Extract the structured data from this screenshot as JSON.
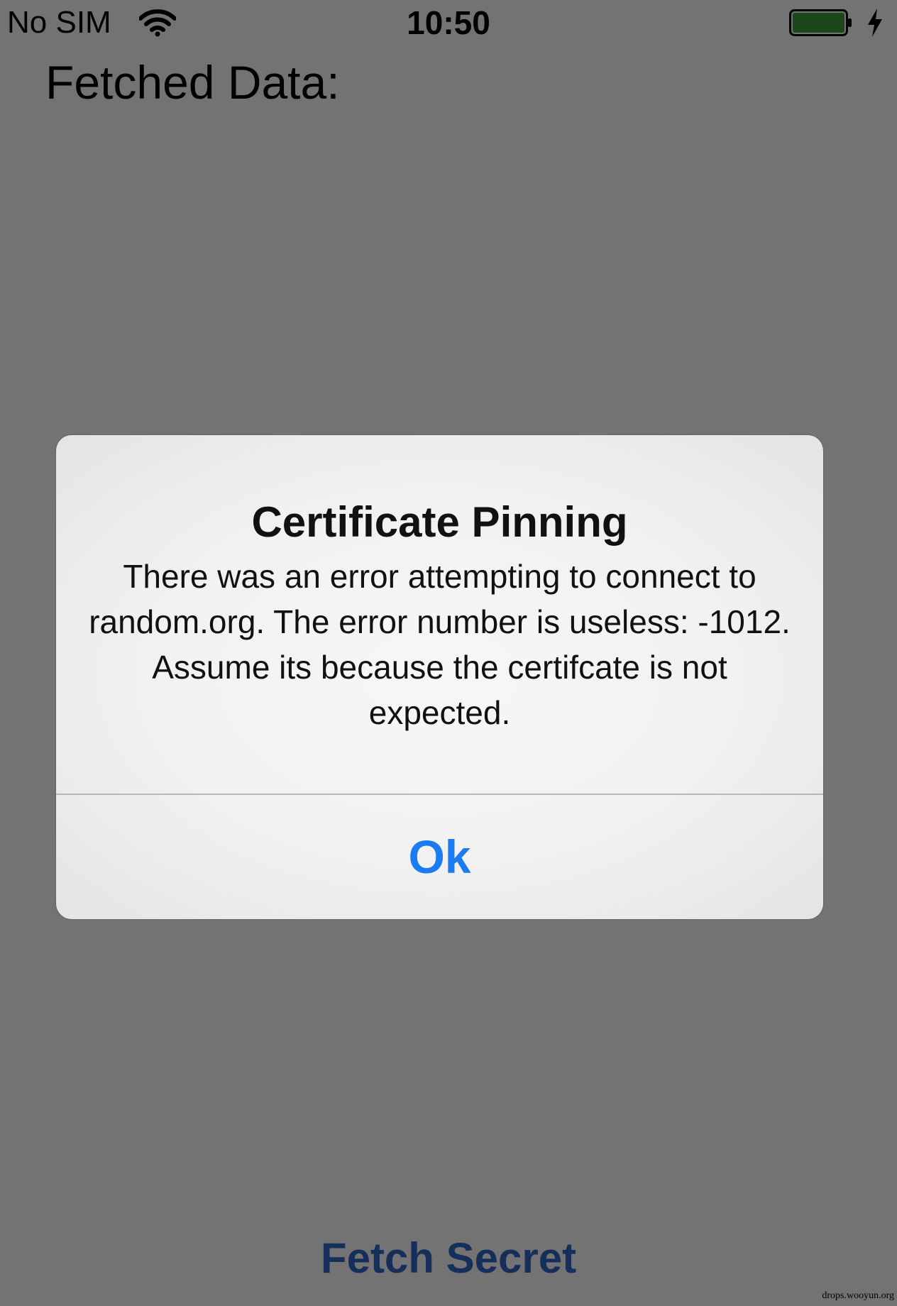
{
  "status_bar": {
    "carrier": "No SIM",
    "time": "10:50",
    "battery_color": "#3aa03a"
  },
  "main": {
    "fetched_label": "Fetched Data:",
    "fetch_button_label": "Fetch Secret"
  },
  "alert": {
    "title": "Certificate Pinning",
    "message": "There was an error attempting to connect to random.org. The error number is useless: -1012. Assume its because the certifcate is not expected.",
    "ok_label": "Ok"
  },
  "watermark": "drops.wooyun.org",
  "colors": {
    "button_blue": "#1a7cf0",
    "overlay": "rgba(0,0,0,0.55)"
  }
}
